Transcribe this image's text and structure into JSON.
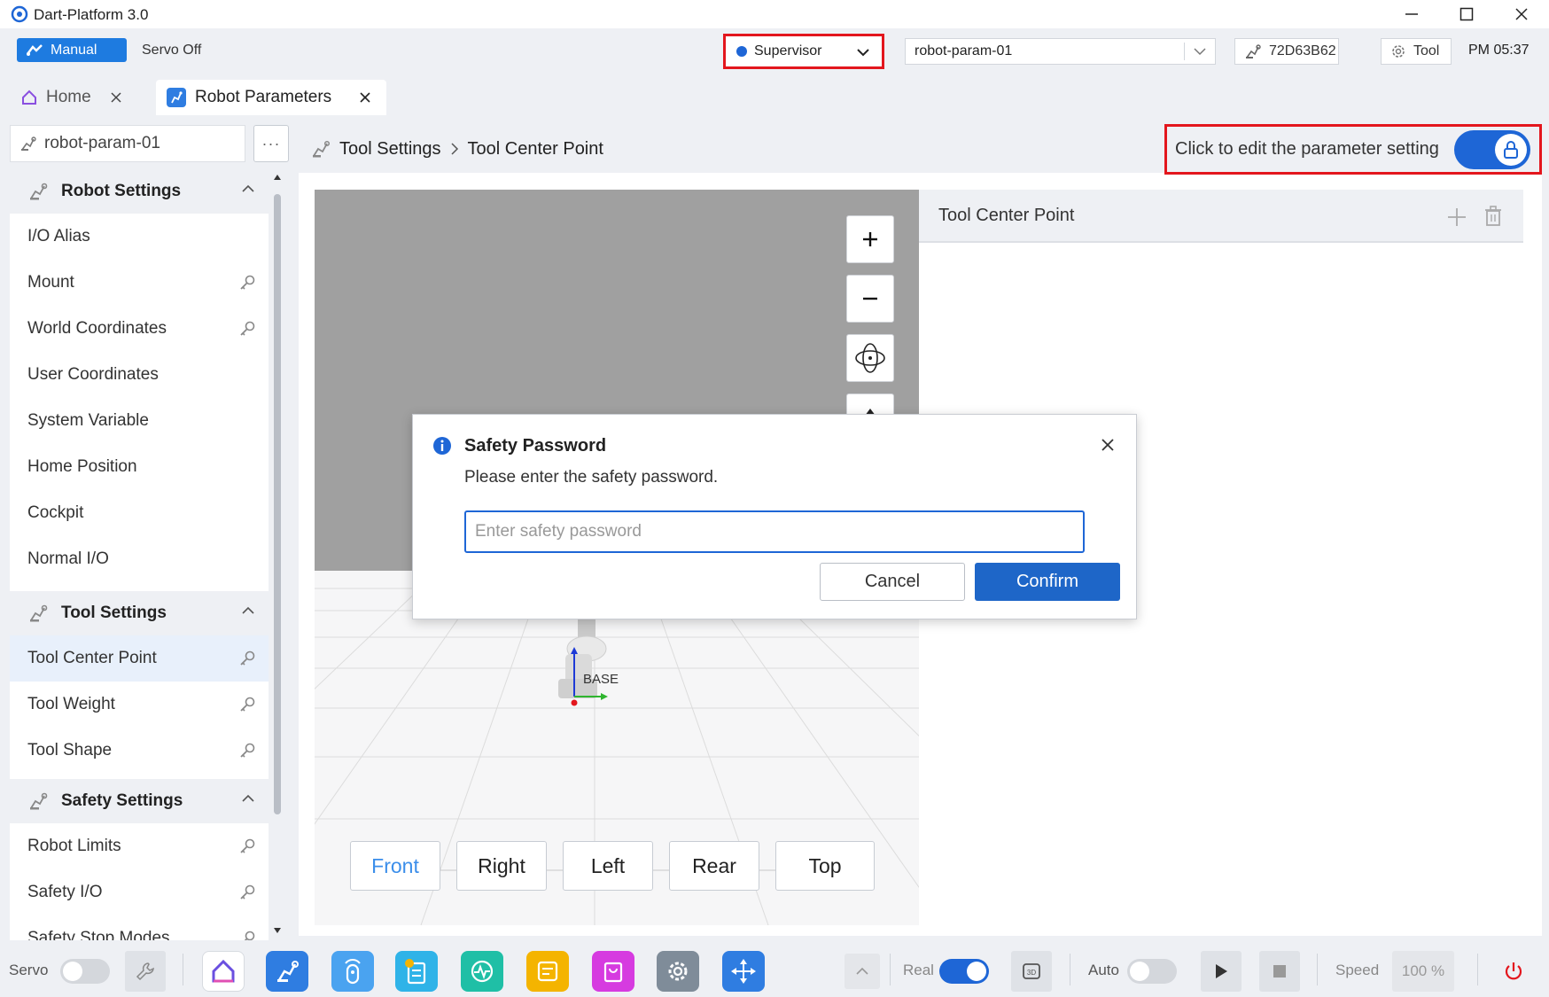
{
  "app": {
    "title": "Dart-Platform 3.0"
  },
  "topbar": {
    "mode_label": "Manual",
    "servo_status": "Servo Off",
    "role": "Supervisor",
    "robot_select": "robot-param-01",
    "robot_id": "72D63B62",
    "tool_label": "Tool",
    "time": "PM 05:37"
  },
  "tabs": [
    {
      "label": "Home",
      "icon": "home-icon"
    },
    {
      "label": "Robot Parameters",
      "icon": "robot-arm-icon"
    }
  ],
  "sidebar": {
    "workcell": "robot-param-01",
    "more_label": "···",
    "sections": [
      {
        "title": "Robot Settings",
        "items": [
          {
            "label": "I/O Alias",
            "locked": false
          },
          {
            "label": "Mount",
            "locked": true
          },
          {
            "label": "World Coordinates",
            "locked": true
          },
          {
            "label": "User Coordinates",
            "locked": false
          },
          {
            "label": "System Variable",
            "locked": false
          },
          {
            "label": "Home Position",
            "locked": false
          },
          {
            "label": "Cockpit",
            "locked": false
          },
          {
            "label": "Normal I/O",
            "locked": false
          }
        ]
      },
      {
        "title": "Tool Settings",
        "items": [
          {
            "label": "Tool Center Point",
            "locked": true,
            "selected": true
          },
          {
            "label": "Tool Weight",
            "locked": true
          },
          {
            "label": "Tool Shape",
            "locked": true
          }
        ]
      },
      {
        "title": "Safety Settings",
        "items": [
          {
            "label": "Robot Limits",
            "locked": true
          },
          {
            "label": "Safety I/O",
            "locked": true
          },
          {
            "label": "Safety Stop Modes",
            "locked": true
          }
        ]
      }
    ]
  },
  "breadcrumb": {
    "parent": "Tool Settings",
    "current": "Tool Center Point"
  },
  "edit_toggle": {
    "label": "Click to edit the parameter setting"
  },
  "viewport": {
    "base_label": "BASE",
    "view_buttons": [
      "Front",
      "Right",
      "Left",
      "Rear",
      "Top"
    ],
    "active_view": "Front"
  },
  "tcp_panel": {
    "title": "Tool Center Point"
  },
  "modal": {
    "title": "Safety Password",
    "message": "Please enter the safety password.",
    "placeholder": "Enter safety password",
    "cancel": "Cancel",
    "confirm": "Confirm"
  },
  "bottombar": {
    "servo_label": "Servo",
    "real_label": "Real",
    "auto_label": "Auto",
    "speed_label": "Speed",
    "speed_value": "100 %",
    "apps": [
      {
        "name": "home-app-icon",
        "color": "#ffffff"
      },
      {
        "name": "robot-app-icon",
        "color": "#2f7de1"
      },
      {
        "name": "remote-app-icon",
        "color": "#4aa3f0"
      },
      {
        "name": "task-app-icon",
        "color": "#2fb3e8"
      },
      {
        "name": "monitor-app-icon",
        "color": "#1fbfa6"
      },
      {
        "name": "notes-app-icon",
        "color": "#f4b400"
      },
      {
        "name": "store-app-icon",
        "color": "#d63be0"
      },
      {
        "name": "settings-app-icon",
        "color": "#7f8c99"
      },
      {
        "name": "jog-app-icon",
        "color": "#2f7de1"
      }
    ]
  }
}
